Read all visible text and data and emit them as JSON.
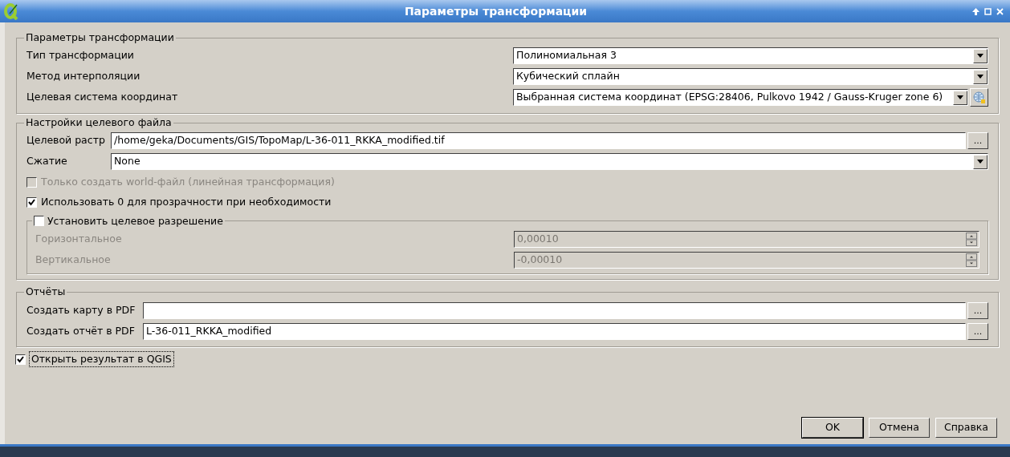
{
  "window": {
    "title": "Параметры трансформации"
  },
  "transform_group": {
    "title": "Параметры трансформации",
    "rows": [
      {
        "label": "Тип трансформации",
        "value": "Полиномиальная 3",
        "kind": "combo"
      },
      {
        "label": "Метод интерполяции",
        "value": "Кубический сплайн",
        "kind": "combo"
      },
      {
        "label": "Целевая система координат",
        "value": "Выбранная система координат (EPSG:28406, Pulkovo 1942 / Gauss-Kruger zone 6)",
        "kind": "combo-with-button"
      }
    ]
  },
  "output_group": {
    "title": "Настройки целевого файла",
    "target_raster": {
      "label": "Целевой растр",
      "value": "/home/geka/Documents/GIS/TopoMap/L-36-011_RKKA_modified.tif",
      "button": "..."
    },
    "compression": {
      "label": "Сжатие",
      "value": "None"
    },
    "options": [
      {
        "label": "Только создать world-файл (линейная трансформация)",
        "checked": false,
        "disabled": true
      },
      {
        "label": "Использовать 0 для прозрачности при необходимости",
        "checked": true,
        "disabled": false
      }
    ],
    "resolution": {
      "title": "Установить целевое разрешение",
      "checked": false,
      "fields": [
        {
          "label": "Горизонтальное",
          "value": "0,00010",
          "disabled": true
        },
        {
          "label": "Вертикальное",
          "value": "-0,00010",
          "disabled": true
        }
      ]
    }
  },
  "reports_group": {
    "title": "Отчёты",
    "rows": [
      {
        "label": "Создать карту в PDF",
        "value": "",
        "button": "..."
      },
      {
        "label": "Создать отчёт в PDF",
        "value": "L-36-011_RKKA_modified",
        "button": "..."
      }
    ]
  },
  "open_result": {
    "label": "Открыть результат в QGIS",
    "checked": true,
    "focused": true
  },
  "buttons": [
    {
      "label": "OK",
      "default": true
    },
    {
      "label": "Отмена",
      "default": false
    },
    {
      "label": "Справка",
      "default": false
    }
  ]
}
